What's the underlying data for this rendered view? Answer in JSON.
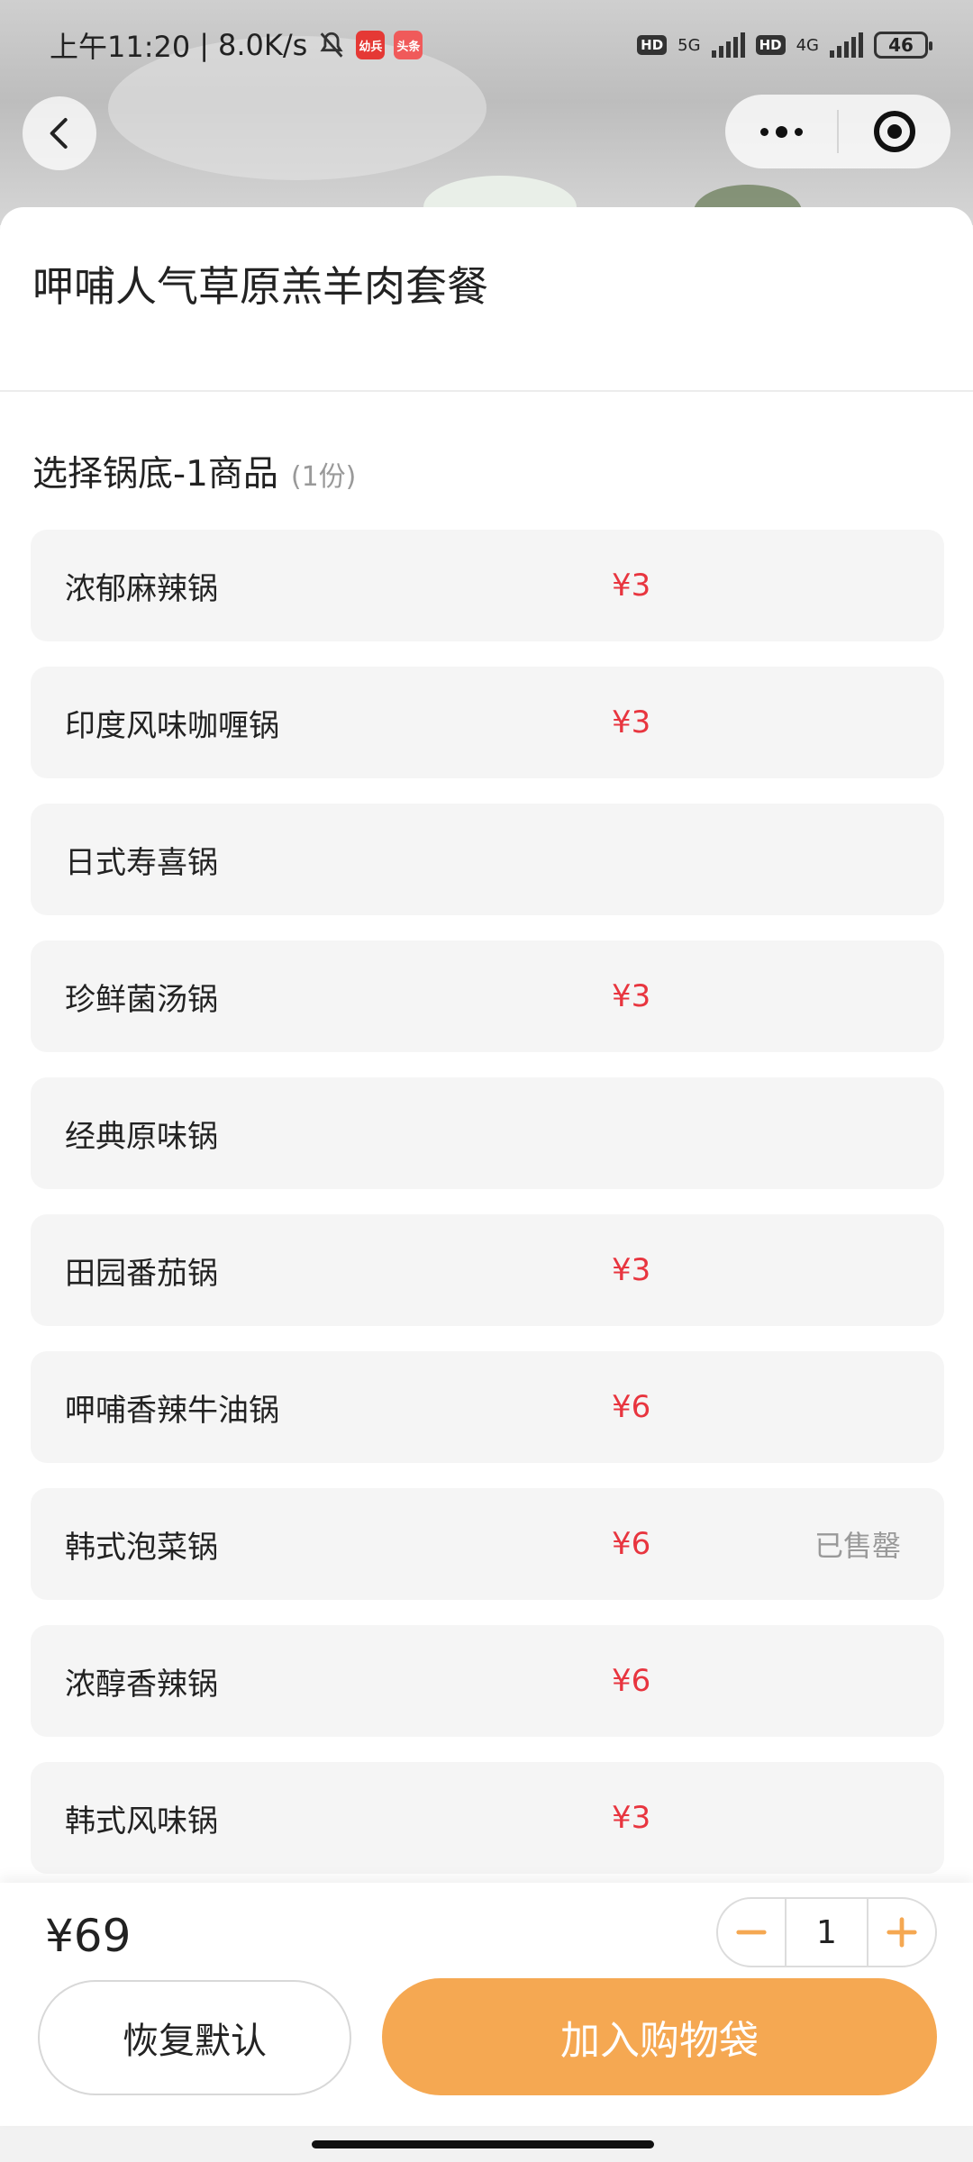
{
  "status_bar": {
    "time": "上午11:20",
    "net_speed": "8.0K/s",
    "badge1": "幼兵",
    "badge2": "头条",
    "hd": "HD",
    "net1": "5G",
    "net2": "4G",
    "battery": "46"
  },
  "product": {
    "title": "呷哺人气草原羔羊肉套餐"
  },
  "section": {
    "title": "选择锅底-1商品",
    "sub": "(1份)"
  },
  "options": [
    {
      "name": "浓郁麻辣锅",
      "price": "¥3",
      "status": ""
    },
    {
      "name": "印度风味咖喱锅",
      "price": "¥3",
      "status": ""
    },
    {
      "name": "日式寿喜锅",
      "price": "",
      "status": ""
    },
    {
      "name": "珍鲜菌汤锅",
      "price": "¥3",
      "status": ""
    },
    {
      "name": "经典原味锅",
      "price": "",
      "status": ""
    },
    {
      "name": "田园番茄锅",
      "price": "¥3",
      "status": ""
    },
    {
      "name": "呷哺香辣牛油锅",
      "price": "¥6",
      "status": ""
    },
    {
      "name": "韩式泡菜锅",
      "price": "¥6",
      "status": "已售罄"
    },
    {
      "name": "浓醇香辣锅",
      "price": "¥6",
      "status": ""
    },
    {
      "name": "韩式风味锅",
      "price": "¥3",
      "status": ""
    }
  ],
  "bottom": {
    "total": "¥69",
    "qty": "1",
    "reset_label": "恢复默认",
    "add_label": "加入购物袋"
  },
  "colors": {
    "accent": "#f5a852",
    "price": "#e8353f"
  }
}
